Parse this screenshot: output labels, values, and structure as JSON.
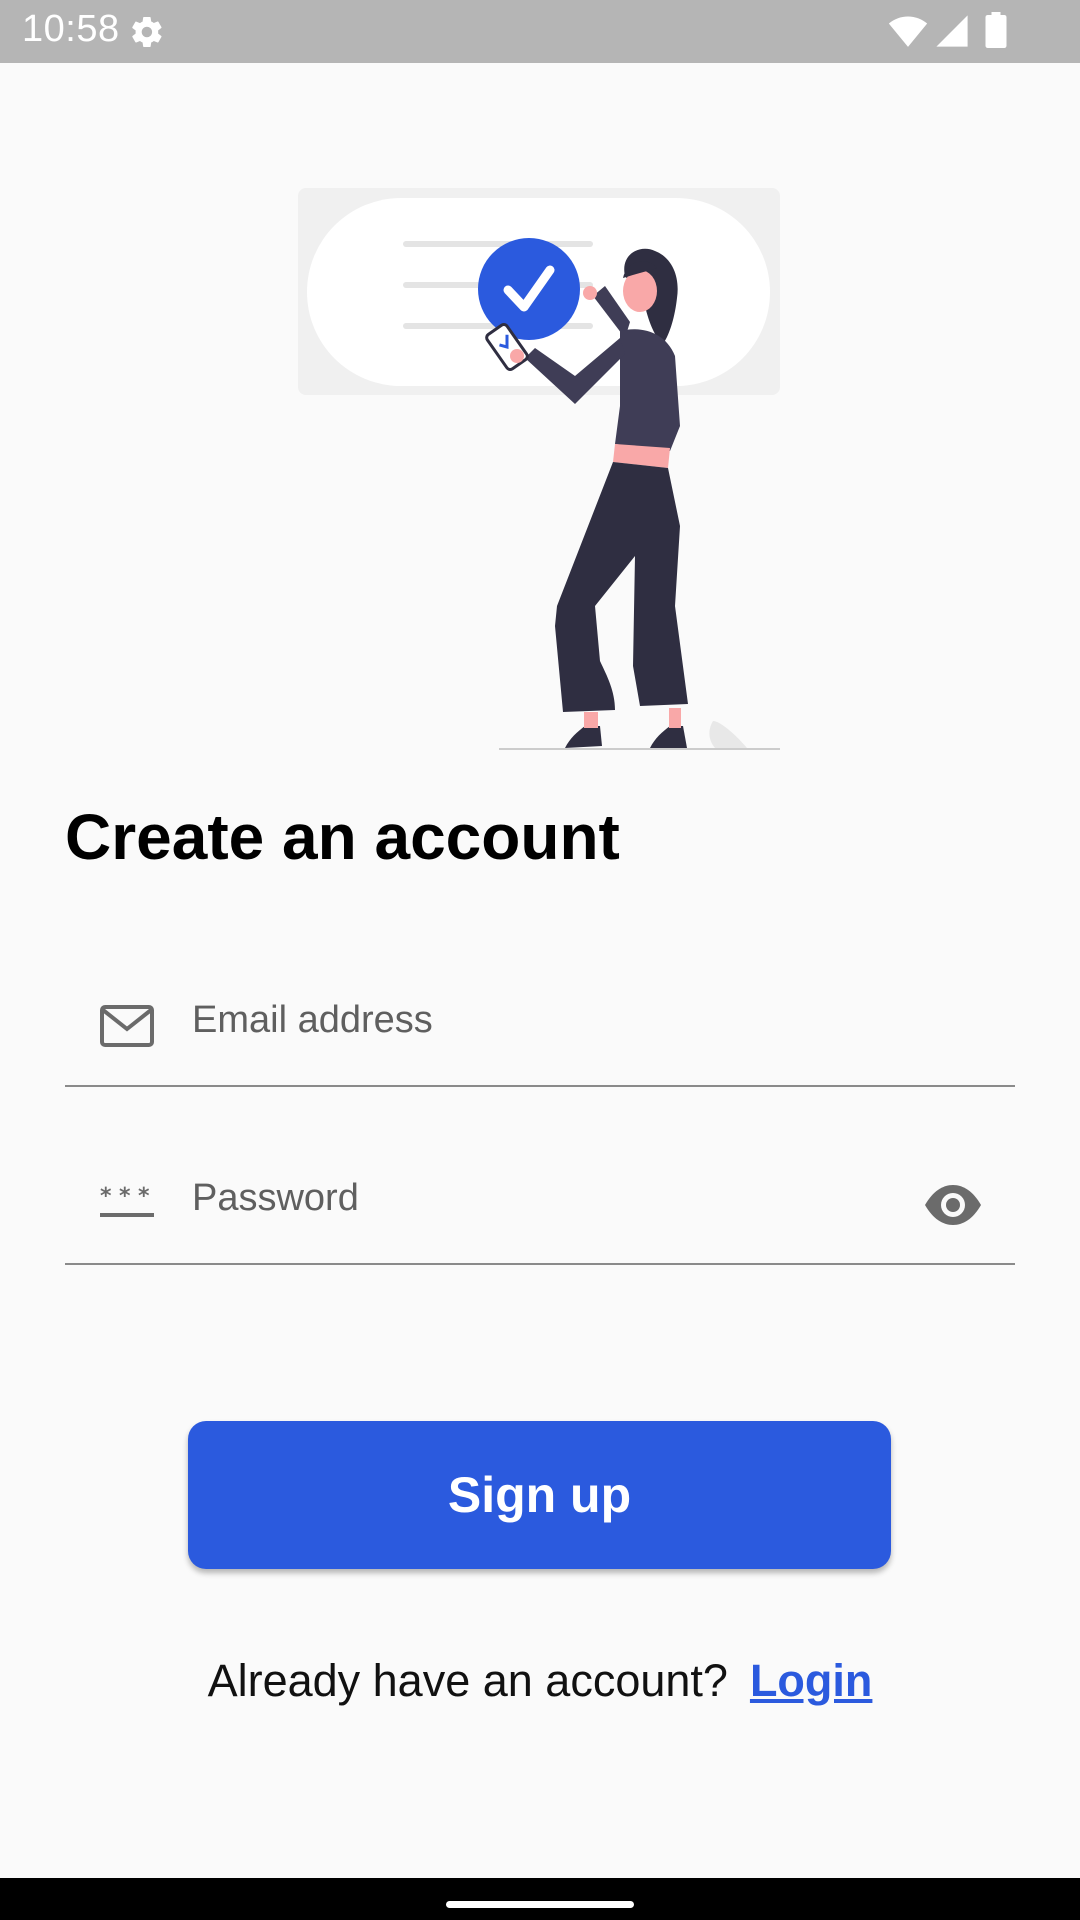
{
  "status_bar": {
    "time": "10:58",
    "icons": [
      "gear-icon",
      "wifi-icon",
      "signal-icon",
      "battery-icon"
    ]
  },
  "illustration": {
    "name": "woman-checkmark-illustration",
    "accent_color": "#2b5ade"
  },
  "page": {
    "title": "Create an account"
  },
  "form": {
    "email": {
      "placeholder": "Email address",
      "value": "",
      "icon": "mail-icon"
    },
    "password": {
      "placeholder": "Password",
      "value": "",
      "icon": "password-asterisk-icon",
      "toggle_icon": "eye-icon"
    }
  },
  "actions": {
    "signup_label": "Sign up",
    "login_prompt": "Already have an account?",
    "login_label": "Login"
  },
  "colors": {
    "accent": "#2b5ade",
    "background": "#fafafa",
    "status_bar": "#b5b5b5"
  }
}
